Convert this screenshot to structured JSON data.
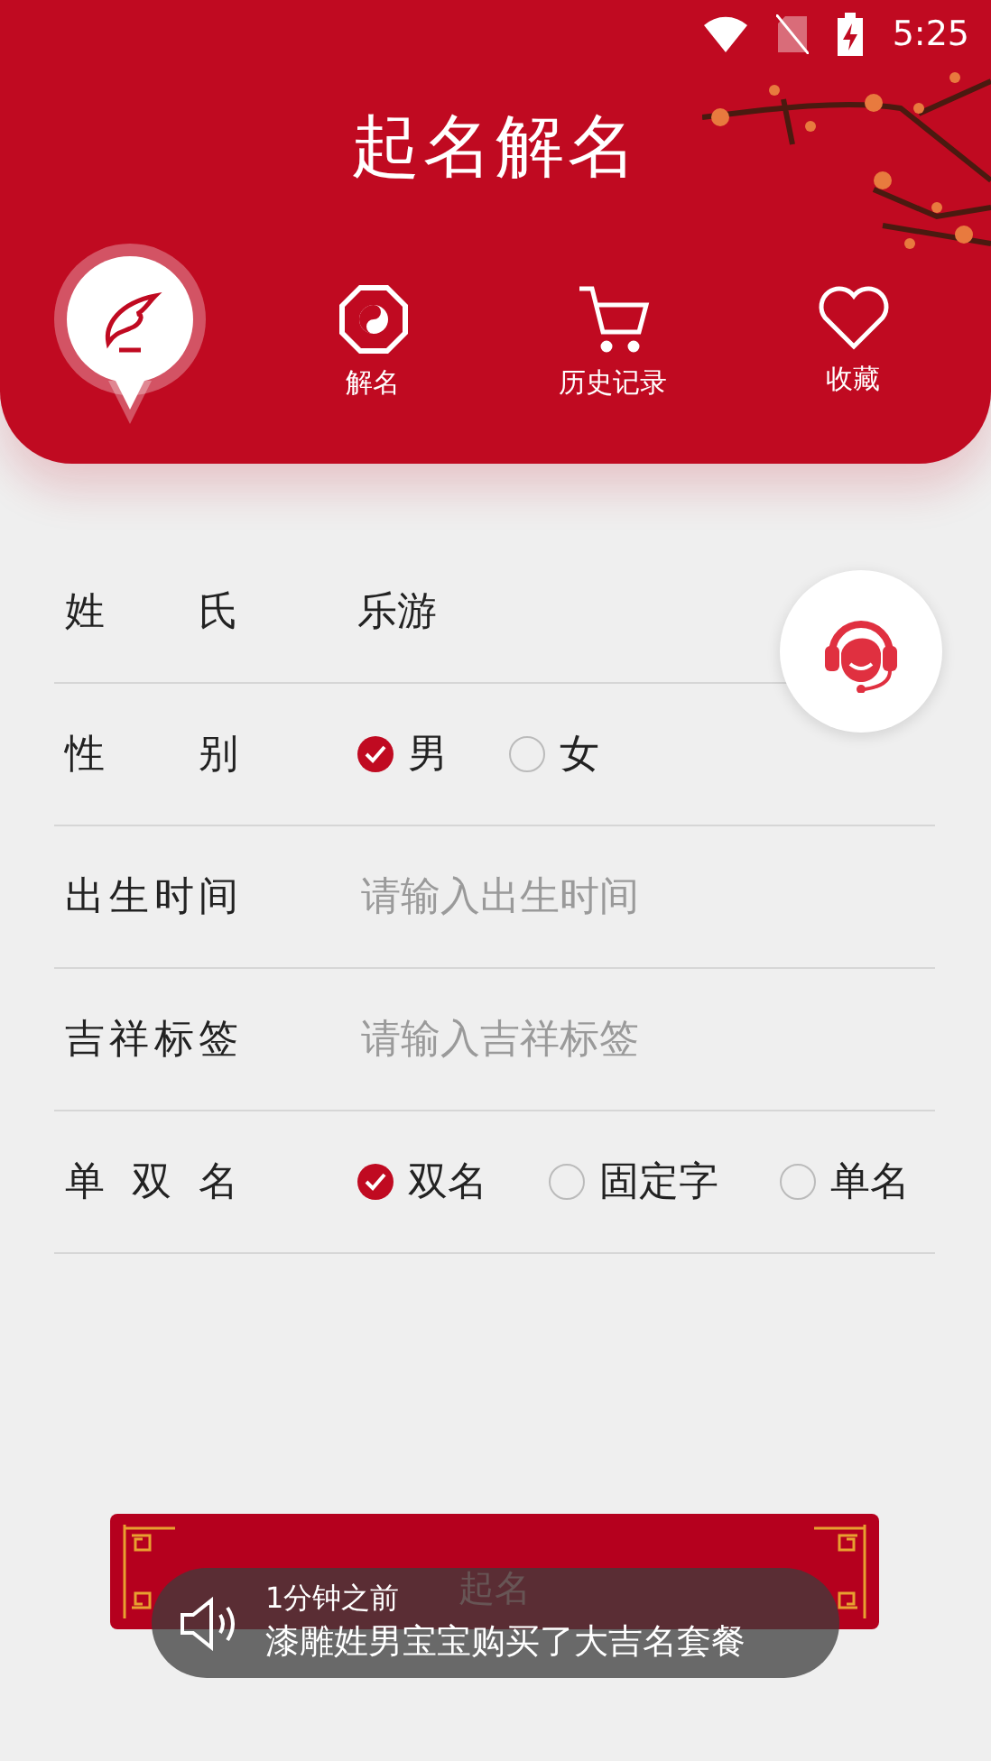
{
  "status_bar": {
    "time": "5:25"
  },
  "header": {
    "title": "起名解名"
  },
  "nav": [
    {
      "selected": true
    },
    {
      "label": "解名",
      "selected": false
    },
    {
      "label": "历史记录",
      "selected": false
    },
    {
      "label": "收藏",
      "selected": false
    }
  ],
  "form": [
    {
      "kind": "text",
      "label": "姓 氏",
      "value": "乐游"
    },
    {
      "kind": "radio",
      "label": "性 别",
      "options": [
        {
          "label": "男",
          "selected": true
        },
        {
          "label": "女",
          "selected": false
        }
      ]
    },
    {
      "kind": "input",
      "label": "出生时间",
      "placeholder": "请输入出生时间"
    },
    {
      "kind": "input",
      "label": "吉祥标签",
      "placeholder": "请输入吉祥标签"
    },
    {
      "kind": "radio",
      "label": "单 双 名",
      "options": [
        {
          "label": "双名",
          "selected": true
        },
        {
          "label": "固定字",
          "selected": false
        },
        {
          "label": "单名",
          "selected": false
        }
      ]
    }
  ],
  "submit": "起名",
  "toast": {
    "time": "1分钟之前",
    "message": "漆雕姓男宝宝购买了大吉名套餐"
  }
}
